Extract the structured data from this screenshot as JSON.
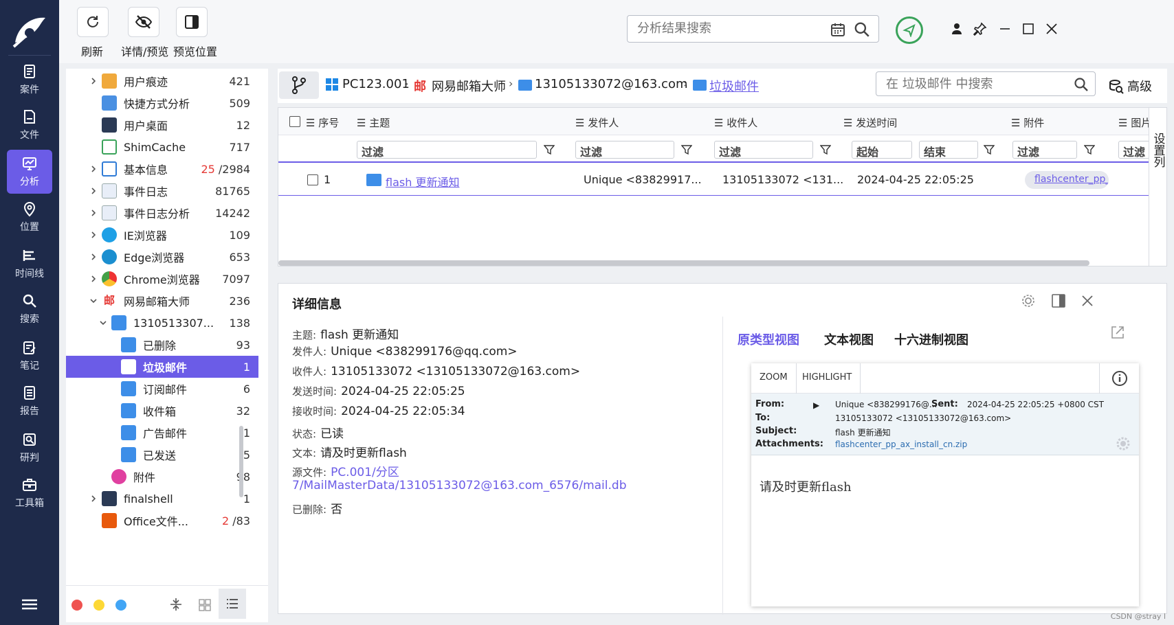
{
  "toolbar": {
    "refresh_label": "刷新",
    "detail_preview_label": "详情/预览",
    "preview_position_label": "预览位置",
    "search_placeholder": "分析结果搜索"
  },
  "rail": {
    "items": [
      {
        "label": "案件"
      },
      {
        "label": "文件"
      },
      {
        "label": "分析"
      },
      {
        "label": "位置"
      },
      {
        "label": "时间线"
      },
      {
        "label": "搜索"
      },
      {
        "label": "笔记"
      },
      {
        "label": "报告"
      },
      {
        "label": "研判"
      },
      {
        "label": "工具箱"
      }
    ]
  },
  "tree": {
    "rows": [
      {
        "label": "用户痕迹",
        "count": "421"
      },
      {
        "label": "快捷方式分析",
        "count": "509"
      },
      {
        "label": "用户桌面",
        "count": "12"
      },
      {
        "label": "ShimCache",
        "count": "717"
      },
      {
        "label": "基本信息",
        "count_red": "25",
        "count": "/2984"
      },
      {
        "label": "事件日志",
        "count": "81765"
      },
      {
        "label": "事件日志分析",
        "count": "14242"
      },
      {
        "label": "IE浏览器",
        "count": "109"
      },
      {
        "label": "Edge浏览器",
        "count": "653"
      },
      {
        "label": "Chrome浏览器",
        "count": "7097"
      },
      {
        "label": "网易邮箱大师",
        "count": "236"
      },
      {
        "label": "1310513307...",
        "count": "138"
      },
      {
        "label": "已删除",
        "count": "93"
      },
      {
        "label": "垃圾邮件",
        "count": "1"
      },
      {
        "label": "订阅邮件",
        "count": "6"
      },
      {
        "label": "收件箱",
        "count": "32"
      },
      {
        "label": "广告邮件",
        "count": "1"
      },
      {
        "label": "已发送",
        "count": "5"
      },
      {
        "label": "附件",
        "count": "98"
      },
      {
        "label": "finalshell",
        "count": "1"
      },
      {
        "label": "Office文件...",
        "count_red": "2",
        "count": "/83"
      }
    ]
  },
  "breadcrumb": {
    "items": [
      "PC123.001",
      "网易邮箱大师",
      "13105133072@163.com",
      "垃圾邮件"
    ],
    "search_placeholder": "在 垃圾邮件 中搜索",
    "advanced_label": "高级"
  },
  "grid": {
    "headers": [
      "序号",
      "主题",
      "发件人",
      "收件人",
      "发送时间",
      "附件",
      "图片"
    ],
    "filter_placeholder": "过滤",
    "filter_start": "起始",
    "filter_end": "结束",
    "settings_label": "设置列",
    "rows": [
      {
        "index": "1",
        "subject": "flash 更新通知",
        "sender": "Unique <83829917...",
        "recipient": "13105133072 <131...",
        "time": "2024-04-25 22:05:25",
        "attachment": "flashcenter_pp_..."
      }
    ]
  },
  "detail": {
    "title": "详细信息",
    "fields": [
      {
        "key": "主题:",
        "value": "flash 更新通知"
      },
      {
        "key": "发件人:",
        "value": "Unique <838299176@qq.com>"
      },
      {
        "key": "收件人:",
        "value": "13105133072 <13105133072@163.com>"
      },
      {
        "key": "发送时间:",
        "value": "2024-04-25 22:05:25"
      },
      {
        "key": "接收时间:",
        "value": "2024-04-25 22:05:34"
      },
      {
        "key": "状态:",
        "value": "已读"
      },
      {
        "key": "文本:",
        "value": "请及时更新flash"
      },
      {
        "key": "源文件:",
        "value": "PC.001/分区",
        "value2": "7/MailMasterData/13105133072@163.com_6576/mail.db"
      },
      {
        "key": "已删除:",
        "value": "否"
      }
    ],
    "tabs": [
      "原类型视图",
      "文本视图",
      "十六进制视图"
    ]
  },
  "preview": {
    "zoom_label": "ZOOM",
    "highlight_label": "HIGHLIGHT",
    "from_key": "From:",
    "from_value": "Unique <838299176@...",
    "sent_key": "Sent:",
    "sent_value": "2024-04-25 22:05:25 +0800 CST",
    "to_key": "To:",
    "to_value": "13105133072 <13105133072@163.com>",
    "subject_key": "Subject:",
    "subject_value": "flash 更新通知",
    "attachments_key": "Attachments:",
    "attachments_value": "flashcenter_pp_ax_install_cn.zip",
    "body": "请及时更新flash"
  },
  "watermark": "CSDN @stray l",
  "colors": {
    "accent": "#6b5ce7",
    "rail": "#1e2a4a",
    "ok_ring": "#3aa35a"
  }
}
